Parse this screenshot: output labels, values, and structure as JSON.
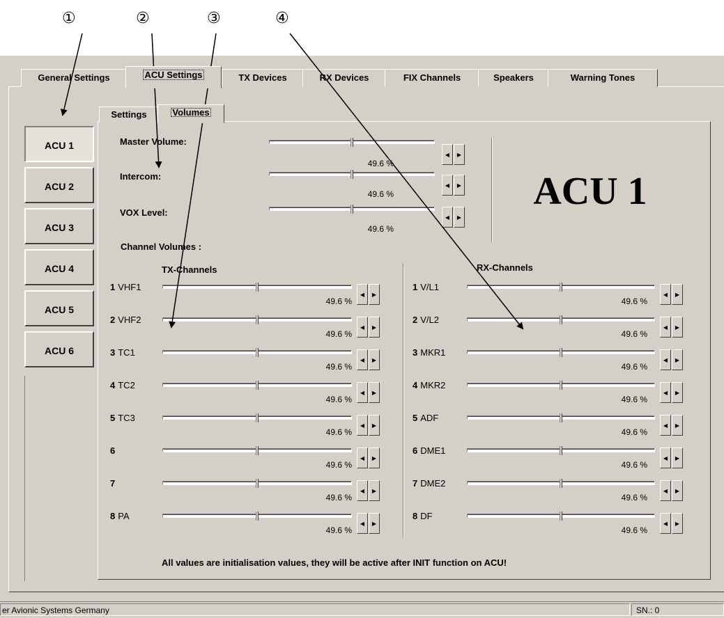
{
  "callouts": [
    "①",
    "②",
    "③",
    "④"
  ],
  "main_tabs": [
    "General Settings",
    "ACU Settings",
    "TX Devices",
    "RX Devices",
    "FIX Channels",
    "Speakers",
    "Warning Tones"
  ],
  "sub_tabs": [
    "Settings",
    "Volumes"
  ],
  "acu_buttons": [
    "ACU 1",
    "ACU 2",
    "ACU 3",
    "ACU 4",
    "ACU 5",
    "ACU 6"
  ],
  "big_title": "ACU 1",
  "master": {
    "master_volume": {
      "label": "Master Volume:",
      "value": "49.6 %",
      "level": 0.496
    },
    "intercom": {
      "label": "Intercom:",
      "value": "49.6 %",
      "level": 0.496
    },
    "vox_level": {
      "label": "VOX Level:",
      "value": "49.6 %",
      "level": 0.496
    }
  },
  "channel_volumes_label": "Channel Volumes :",
  "tx_header": "TX-Channels",
  "rx_header": "RX-Channels",
  "tx_channels": [
    {
      "num": "1",
      "name": "VHF1",
      "value": "49.6 %",
      "level": 0.496
    },
    {
      "num": "2",
      "name": "VHF2",
      "value": "49.6 %",
      "level": 0.496
    },
    {
      "num": "3",
      "name": "TC1",
      "value": "49.6 %",
      "level": 0.496
    },
    {
      "num": "4",
      "name": "TC2",
      "value": "49.6 %",
      "level": 0.496
    },
    {
      "num": "5",
      "name": "TC3",
      "value": "49.6 %",
      "level": 0.496
    },
    {
      "num": "6",
      "name": "",
      "value": "49.6 %",
      "level": 0.496
    },
    {
      "num": "7",
      "name": "",
      "value": "49.6 %",
      "level": 0.496
    },
    {
      "num": "8",
      "name": "PA",
      "value": "49.6 %",
      "level": 0.496
    }
  ],
  "rx_channels": [
    {
      "num": "1",
      "name": "V/L1",
      "value": "49.6 %",
      "level": 0.496
    },
    {
      "num": "2",
      "name": "V/L2",
      "value": "49.6 %",
      "level": 0.496
    },
    {
      "num": "3",
      "name": "MKR1",
      "value": "49.6 %",
      "level": 0.496
    },
    {
      "num": "4",
      "name": "MKR2",
      "value": "49.6 %",
      "level": 0.496
    },
    {
      "num": "5",
      "name": "ADF",
      "value": "49.6 %",
      "level": 0.496
    },
    {
      "num": "6",
      "name": "DME1",
      "value": "49.6 %",
      "level": 0.496
    },
    {
      "num": "7",
      "name": "DME2",
      "value": "49.6 %",
      "level": 0.496
    },
    {
      "num": "8",
      "name": "DF",
      "value": "49.6 %",
      "level": 0.496
    }
  ],
  "footer_note": "All values are initialisation values, they will be active after INIT function on ACU!",
  "status": {
    "left": "er Avionic Systems Germany",
    "right": "SN.: 0"
  },
  "icons": {
    "spin_left": "triangle-left-icon",
    "spin_right": "triangle-right-icon"
  }
}
